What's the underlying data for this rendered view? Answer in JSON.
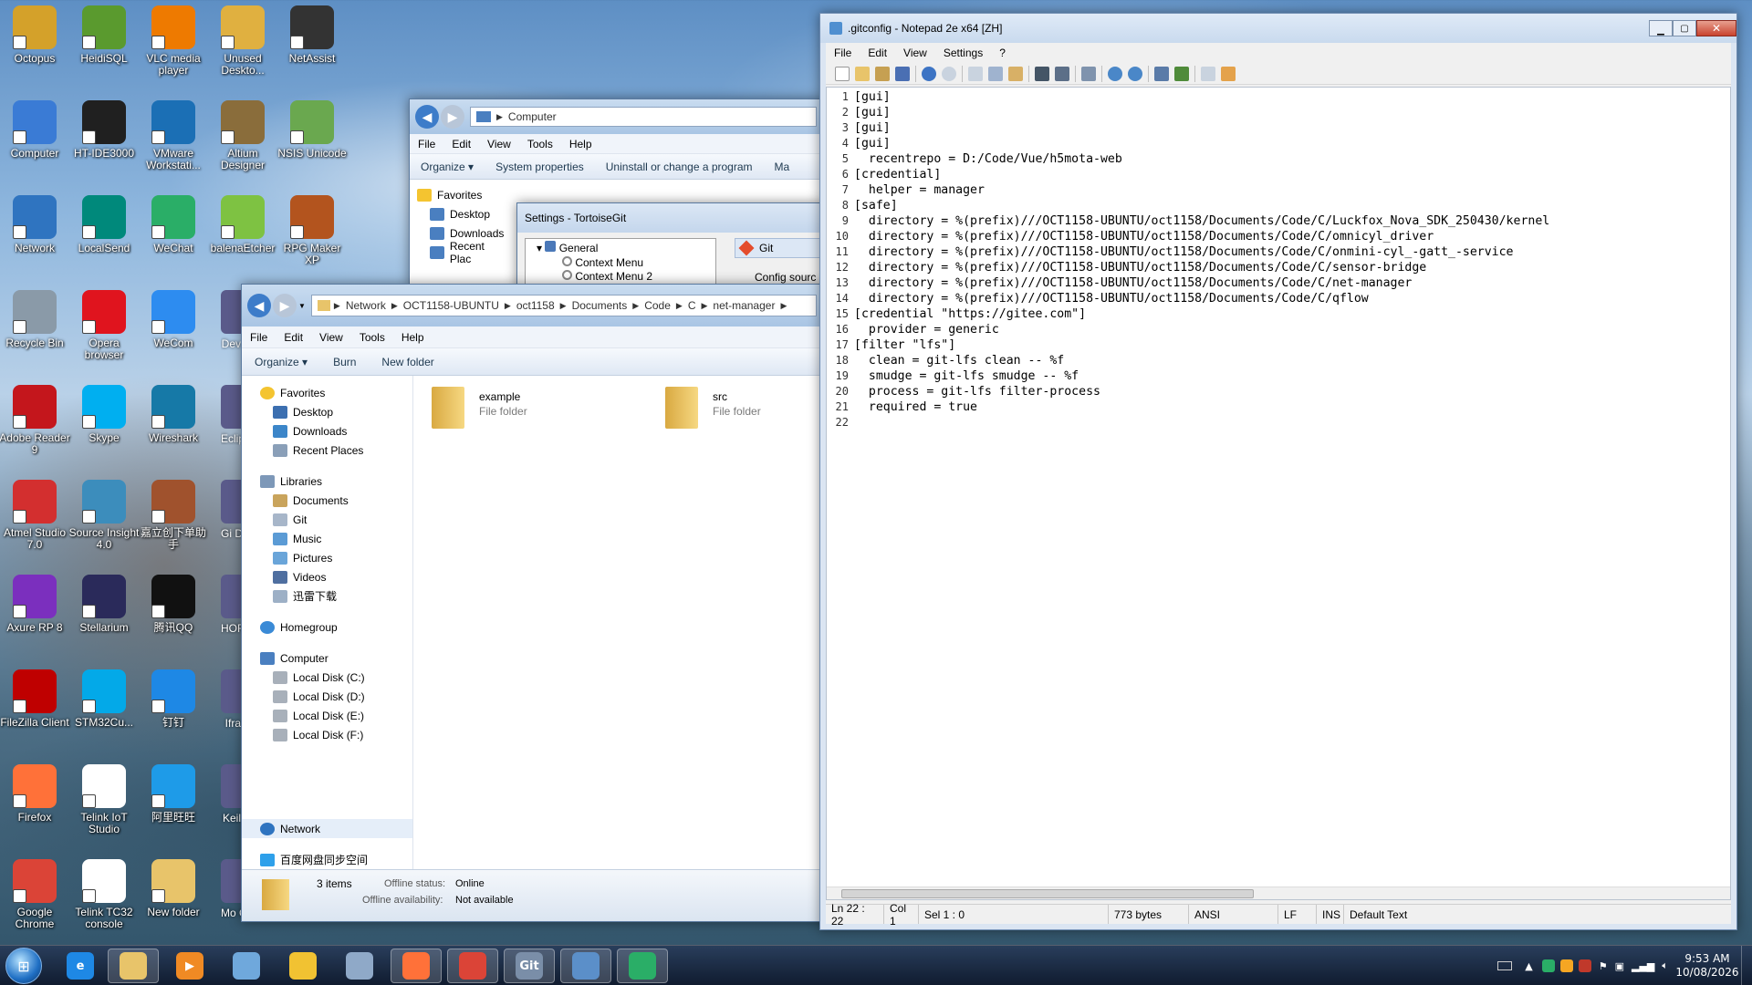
{
  "desktop_icons": [
    {
      "label": "Octopus",
      "color": "#d4a12a"
    },
    {
      "label": "HeidiSQL",
      "color": "#5a9a2e"
    },
    {
      "label": "VLC media player",
      "color": "#ee7a00"
    },
    {
      "label": "Unused Deskto...",
      "color": "#e0b040"
    },
    {
      "label": "NetAssist",
      "color": "#333333"
    },
    {
      "label": "Computer",
      "color": "#3a7bd5"
    },
    {
      "label": "HT-IDE3000",
      "color": "#202020"
    },
    {
      "label": "VMware Workstati...",
      "color": "#1b6fb5"
    },
    {
      "label": "Altium Designer",
      "color": "#8a6d3b"
    },
    {
      "label": "NSIS Unicode",
      "color": "#6aa84f"
    },
    {
      "label": "Network",
      "color": "#2f74c0"
    },
    {
      "label": "LocalSend",
      "color": "#00897b"
    },
    {
      "label": "WeChat",
      "color": "#2aae67"
    },
    {
      "label": "balenaEtcher",
      "color": "#7ec242"
    },
    {
      "label": "RPG Maker XP",
      "color": "#b3541e"
    },
    {
      "label": "Recycle Bin",
      "color": "#8a9aa8"
    },
    {
      "label": "Opera browser",
      "color": "#e0141e"
    },
    {
      "label": "WeCom",
      "color": "#2d8cf0"
    },
    {
      "label": "Adobe Reader 9",
      "color": "#c4161c"
    },
    {
      "label": "Skype",
      "color": "#00aff0"
    },
    {
      "label": "Wireshark",
      "color": "#1679a7"
    },
    {
      "label": "Atmel Studio 7.0",
      "color": "#d32f2f"
    },
    {
      "label": "Source Insight 4.0",
      "color": "#3c8dbc"
    },
    {
      "label": "嘉立创下单助手",
      "color": "#a0522d"
    },
    {
      "label": "Axure RP 8",
      "color": "#7b2fbe"
    },
    {
      "label": "Stellarium",
      "color": "#2a2a5a"
    },
    {
      "label": "腾讯QQ",
      "color": "#111111"
    },
    {
      "label": "FileZilla Client",
      "color": "#bf0000"
    },
    {
      "label": "STM32Cu...",
      "color": "#03a9e8"
    },
    {
      "label": "钉钉",
      "color": "#1e88e5"
    },
    {
      "label": "Firefox",
      "color": "#ff7139"
    },
    {
      "label": "Telink IoT Studio",
      "color": "#ffffff"
    },
    {
      "label": "阿里旺旺",
      "color": "#1e9be8"
    },
    {
      "label": "Google Chrome",
      "color": "#db4437"
    },
    {
      "label": "Telink TC32 console",
      "color": "#ffffff"
    },
    {
      "label": "New folder",
      "color": "#e8c46a"
    }
  ],
  "partial_icons": [
    "Dev",
    "Eclip N",
    "Gi De",
    "HOF",
    "Ifra",
    "Keil",
    "Mo Compass"
  ],
  "explorer_back": {
    "address": "Computer",
    "menu": [
      "File",
      "Edit",
      "View",
      "Tools",
      "Help"
    ],
    "commands": [
      "Organize ▾",
      "System properties",
      "Uninstall or change a program",
      "Ma"
    ],
    "nav": [
      "Favorites",
      "Desktop",
      "Downloads",
      "Recent Plac"
    ]
  },
  "tortoise": {
    "title": "Settings - TortoiseGit",
    "tree": [
      "General",
      "Context Menu",
      "Context Menu 2"
    ],
    "right_title": "Git",
    "right_sub": "Config sourc"
  },
  "explorer_front": {
    "address_segments": [
      "Network",
      "OCT1158-UBUNTU",
      "oct1158",
      "Documents",
      "Code",
      "C",
      "net-manager"
    ],
    "menu": [
      "File",
      "Edit",
      "View",
      "Tools",
      "Help"
    ],
    "commands": [
      "Organize ▾",
      "Burn",
      "New folder"
    ],
    "nav": {
      "favorites": "Favorites",
      "favorites_items": [
        "Desktop",
        "Downloads",
        "Recent Places"
      ],
      "libraries": "Libraries",
      "library_items": [
        "Documents",
        "Git",
        "Music",
        "Pictures",
        "Videos",
        "迅雷下载"
      ],
      "homegroup": "Homegroup",
      "computer": "Computer",
      "disks": [
        "Local Disk (C:)",
        "Local Disk (D:)",
        "Local Disk (E:)",
        "Local Disk (F:)"
      ],
      "network": "Network",
      "baidu": "百度网盘同步空间"
    },
    "files": [
      {
        "name": "example",
        "type": "File folder"
      },
      {
        "name": "src",
        "type": "File folder"
      }
    ],
    "status": {
      "items": "3 items",
      "offline_status_label": "Offline status:",
      "offline_status_value": "Online",
      "offline_avail_label": "Offline availability:",
      "offline_avail_value": "Not available"
    }
  },
  "notepad": {
    "title": ".gitconfig - Notepad 2e x64 [ZH]",
    "menu": [
      "File",
      "Edit",
      "View",
      "Settings",
      "?"
    ],
    "lines": [
      "[gui]",
      "[gui]",
      "[gui]",
      "[gui]",
      "  recentrepo = D:/Code/Vue/h5mota-web",
      "[credential]",
      "  helper = manager",
      "[safe]",
      "  directory = %(prefix)///OCT1158-UBUNTU/oct1158/Documents/Code/C/Luckfox_Nova_SDK_250430/kernel",
      "  directory = %(prefix)///OCT1158-UBUNTU/oct1158/Documents/Code/C/omnicyl_driver",
      "  directory = %(prefix)///OCT1158-UBUNTU/oct1158/Documents/Code/C/onmini-cyl_-gatt_-service",
      "  directory = %(prefix)///OCT1158-UBUNTU/oct1158/Documents/Code/C/sensor-bridge",
      "  directory = %(prefix)///OCT1158-UBUNTU/oct1158/Documents/Code/C/net-manager",
      "  directory = %(prefix)///OCT1158-UBUNTU/oct1158/Documents/Code/C/qflow",
      "[credential \"https://gitee.com\"]",
      "  provider = generic",
      "[filter \"lfs\"]",
      "  clean = git-lfs clean -- %f",
      "  smudge = git-lfs smudge -- %f",
      "  process = git-lfs filter-process",
      "  required = true",
      ""
    ],
    "status": {
      "position": "Ln 22 : 22",
      "col": "Col 1",
      "sel": "Sel 1 : 0",
      "size": "773 bytes",
      "encoding": "ANSI",
      "eol": "LF",
      "mode": "INS",
      "scheme": "Default Text"
    }
  },
  "taskbar": {
    "apps": [
      {
        "name": "ie",
        "color": "#1e88e5",
        "glyph": "e"
      },
      {
        "name": "explorer",
        "color": "#e8c46a",
        "glyph": ""
      },
      {
        "name": "media-player",
        "color": "#f08a24",
        "glyph": "▶"
      },
      {
        "name": "notepad",
        "color": "#6fa8dc",
        "glyph": ""
      },
      {
        "name": "paint",
        "color": "#f1c232",
        "glyph": ""
      },
      {
        "name": "calculator",
        "color": "#8fa9c8",
        "glyph": ""
      },
      {
        "name": "firefox",
        "color": "#ff7139",
        "glyph": ""
      },
      {
        "name": "chrome",
        "color": "#db4437",
        "glyph": ""
      },
      {
        "name": "tortoisegit",
        "color": "#7a8ea8",
        "glyph": "Git"
      },
      {
        "name": "notepad2",
        "color": "#5b8fc9",
        "glyph": ""
      },
      {
        "name": "wechat",
        "color": "#2aae67",
        "glyph": ""
      }
    ],
    "time": "9:53 AM",
    "date": "10/08/2026"
  }
}
